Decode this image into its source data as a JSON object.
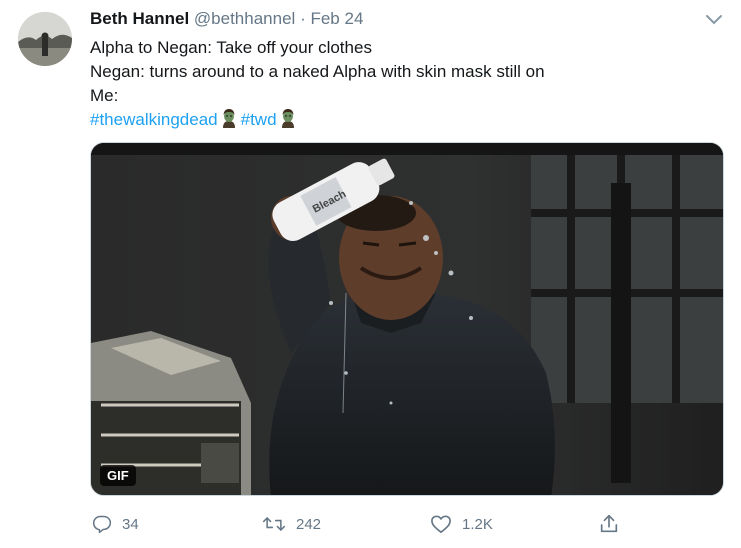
{
  "tweet": {
    "author_name": "Beth Hannel",
    "author_handle": "@bethhannel",
    "separator": "·",
    "date": "Feb 24",
    "lines": [
      "Alpha to Negan: Take off your clothes",
      "Negan: turns around to a naked Alpha with skin mask still on",
      "Me:"
    ],
    "hashtags": [
      "#thewalkingdead",
      "#twd"
    ]
  },
  "media": {
    "badge": "GIF",
    "bottle_text": "Bleach"
  },
  "actions": {
    "reply_count": "34",
    "retweet_count": "242",
    "like_count": "1.2K"
  },
  "colors": {
    "accent": "#1da1f2",
    "muted": "#657786"
  }
}
